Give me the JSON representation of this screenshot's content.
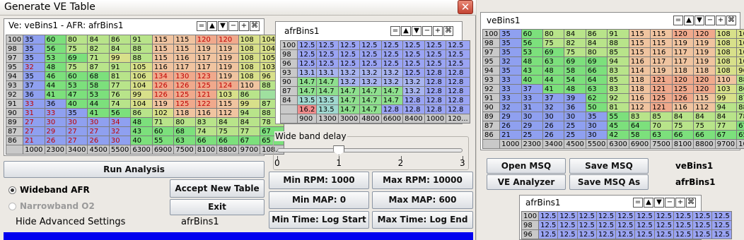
{
  "dialog": {
    "title": "Generate VE Table"
  },
  "left_table": {
    "title": "Ve: veBins1 - AFR: afrBins1",
    "row_headers": [
      "100",
      "98",
      "97",
      "95",
      "94",
      "93",
      "92",
      "91",
      "90",
      "89",
      "87",
      "86",
      "70"
    ],
    "col_headers": [
      "1000",
      "2300",
      "3400",
      "4500",
      "5500",
      "6300",
      "6900",
      "7500",
      "8100",
      "8800",
      "9700",
      "108..."
    ],
    "rows": [
      [
        "35",
        "60",
        "80",
        "84",
        "86",
        "91",
        "115",
        "115",
        "120",
        "120",
        "108",
        "104"
      ],
      [
        "35",
        "56",
        "75",
        "82",
        "84",
        "88",
        "115",
        "115",
        "119",
        "119",
        "108",
        "104"
      ],
      [
        "35",
        "53",
        "69",
        "71",
        "99",
        "88",
        "115",
        "116",
        "117",
        "119",
        "108",
        "105"
      ],
      [
        "32",
        "48",
        "75",
        "87",
        "91",
        "105",
        "116",
        "117",
        "117",
        "119",
        "108",
        "103"
      ],
      [
        "35",
        "46",
        "60",
        "68",
        "81",
        "106",
        "134",
        "130",
        "123",
        "119",
        "108",
        "96"
      ],
      [
        "37",
        "44",
        "53",
        "58",
        "77",
        "104",
        "126",
        "126",
        "125",
        "124",
        "110",
        "88"
      ],
      [
        "36",
        "41",
        "47",
        "53",
        "76",
        "99",
        "126",
        "125",
        "121",
        "103",
        "86",
        ""
      ],
      [
        "33",
        "36",
        "40",
        "44",
        "74",
        "104",
        "119",
        "125",
        "122",
        "115",
        "99",
        "87"
      ],
      [
        "31",
        "33",
        "35",
        "41",
        "56",
        "86",
        "102",
        "118",
        "116",
        "112",
        "94",
        "88"
      ],
      [
        "27",
        "30",
        "30",
        "30",
        "34",
        "48",
        "71",
        "80",
        "83",
        "84",
        "84",
        "78"
      ],
      [
        "27",
        "29",
        "27",
        "27",
        "32",
        "43",
        "60",
        "68",
        "74",
        "75",
        "77",
        "67"
      ],
      [
        "21",
        "26",
        "27",
        "26",
        "30",
        "40",
        "55",
        "63",
        "66",
        "66",
        "67",
        "65"
      ]
    ]
  },
  "afr_small": {
    "title": "afrBins1",
    "row_headers": [
      "100",
      "98",
      "96",
      "93",
      "90",
      "87",
      "84"
    ],
    "col_headers": [
      "900",
      "1300",
      "3000",
      "4800",
      "6600",
      "8400",
      "1000",
      "120..."
    ],
    "rows": [
      [
        "12.5",
        "12.5",
        "12.5",
        "12.5",
        "12.5",
        "12.5",
        "12.5",
        "12.5"
      ],
      [
        "12.5",
        "12.5",
        "12.5",
        "12.5",
        "12.5",
        "12.5",
        "12.5",
        "12.5"
      ],
      [
        "12.5",
        "12.5",
        "12.5",
        "12.5",
        "12.5",
        "12.5",
        "12.5",
        "12.5"
      ],
      [
        "13.1",
        "13.1",
        "13.2",
        "13.2",
        "13.2",
        "12.5",
        "12.8",
        "12.8"
      ],
      [
        "14.7",
        "14.7",
        "13.2",
        "13.2",
        "13.2",
        "13.2",
        "12.8",
        "12.8"
      ],
      [
        "14.7",
        "14.7",
        "14.7",
        "14.7",
        "14.7",
        "13.2",
        "12.8",
        "12.8"
      ],
      [
        "13.5",
        "13.5",
        "14.7",
        "14.7",
        "14.7",
        "12.8",
        "12.8",
        "12.8"
      ],
      [
        "16.2",
        "13.5",
        "14.7",
        "14.7",
        "12.8",
        "12.8",
        "12.8",
        "12.8"
      ]
    ]
  },
  "wideband_delay": {
    "label": "Wide band delay",
    "ticks": [
      "0",
      "1",
      "2",
      "3"
    ],
    "value_fraction": 0.333
  },
  "buttons": {
    "run_analysis": "Run Analysis",
    "accept_new_table": "Accept New Table",
    "exit": "Exit",
    "min_rpm": "Min RPM: 1000",
    "max_rpm": "Max RPM: 10000",
    "min_map": "Min MAP: 0",
    "max_map": "Max MAP: 600",
    "min_time": "Min Time: Log Start",
    "max_time": "Max Time: Log End",
    "open_msq": "Open MSQ",
    "save_msq": "Save MSQ",
    "ve_analyzer": "VE Analyzer",
    "save_msq_as": "Save MSQ As"
  },
  "radio": {
    "wideband": "Wideband AFR",
    "narrowband": "Narrowband O2"
  },
  "advanced": {
    "label": "Hide Advanced Settings",
    "value": "afrBins1"
  },
  "right_table": {
    "title": "veBins1",
    "row_headers": [
      "100",
      "98",
      "97",
      "95",
      "94",
      "93",
      "92",
      "91",
      "90",
      "89",
      "87",
      "86",
      "70"
    ],
    "col_headers": [
      "1000",
      "2300",
      "3400",
      "4500",
      "5500",
      "6300",
      "6900",
      "7500",
      "8100",
      "8800",
      "9700",
      "108..."
    ],
    "rows": [
      [
        "35",
        "60",
        "80",
        "84",
        "86",
        "91",
        "115",
        "115",
        "120",
        "120",
        "108",
        "104"
      ],
      [
        "35",
        "56",
        "75",
        "82",
        "84",
        "88",
        "115",
        "115",
        "119",
        "119",
        "108",
        "104"
      ],
      [
        "35",
        "53",
        "69",
        "75",
        "80",
        "85",
        "115",
        "116",
        "117",
        "119",
        "108",
        "105"
      ],
      [
        "32",
        "48",
        "63",
        "69",
        "69",
        "94",
        "116",
        "117",
        "117",
        "119",
        "108",
        "103"
      ],
      [
        "35",
        "43",
        "48",
        "58",
        "66",
        "83",
        "114",
        "119",
        "118",
        "118",
        "108",
        "96"
      ],
      [
        "33",
        "40",
        "44",
        "54",
        "64",
        "85",
        "118",
        "121",
        "120",
        "120",
        "110",
        "88"
      ],
      [
        "33",
        "37",
        "41",
        "48",
        "63",
        "83",
        "118",
        "121",
        "125",
        "120",
        "103",
        "86"
      ],
      [
        "33",
        "33",
        "37",
        "39",
        "62",
        "92",
        "116",
        "125",
        "126",
        "115",
        "99",
        "87"
      ],
      [
        "32",
        "31",
        "32",
        "36",
        "50",
        "81",
        "112",
        "121",
        "116",
        "112",
        "94",
        "88"
      ],
      [
        "29",
        "30",
        "30",
        "30",
        "35",
        "55",
        "83",
        "85",
        "84",
        "84",
        "84",
        "78"
      ],
      [
        "26",
        "29",
        "26",
        "25",
        "30",
        "45",
        "64",
        "70",
        "75",
        "75",
        "77",
        "67"
      ],
      [
        "21",
        "25",
        "26",
        "25",
        "30",
        "42",
        "58",
        "63",
        "66",
        "66",
        "67",
        "65"
      ]
    ]
  },
  "right_labels": {
    "ve_name": "veBins1",
    "afr_name": "afrBins1"
  },
  "right_afr": {
    "title": "afrBins1",
    "row_headers": [
      "100",
      "98",
      "96"
    ],
    "rows": [
      [
        "12.5",
        "12.5",
        "12.5",
        "12.5",
        "12.5",
        "12.5",
        "12.5",
        "12.5",
        "12.5",
        "12.5"
      ],
      [
        "12.5",
        "12.5",
        "12.5",
        "12.5",
        "12.5",
        "12.5",
        "12.5",
        "12.5",
        "12.5",
        "12.5"
      ],
      [
        "12.5",
        "12.5",
        "12.5",
        "12.5",
        "12.5",
        "12.5",
        "12.5",
        "12.5",
        "12.5",
        "12.5"
      ]
    ]
  },
  "window_buttons": [
    "=",
    "▲",
    "▼",
    "−",
    "+",
    "⌘"
  ]
}
